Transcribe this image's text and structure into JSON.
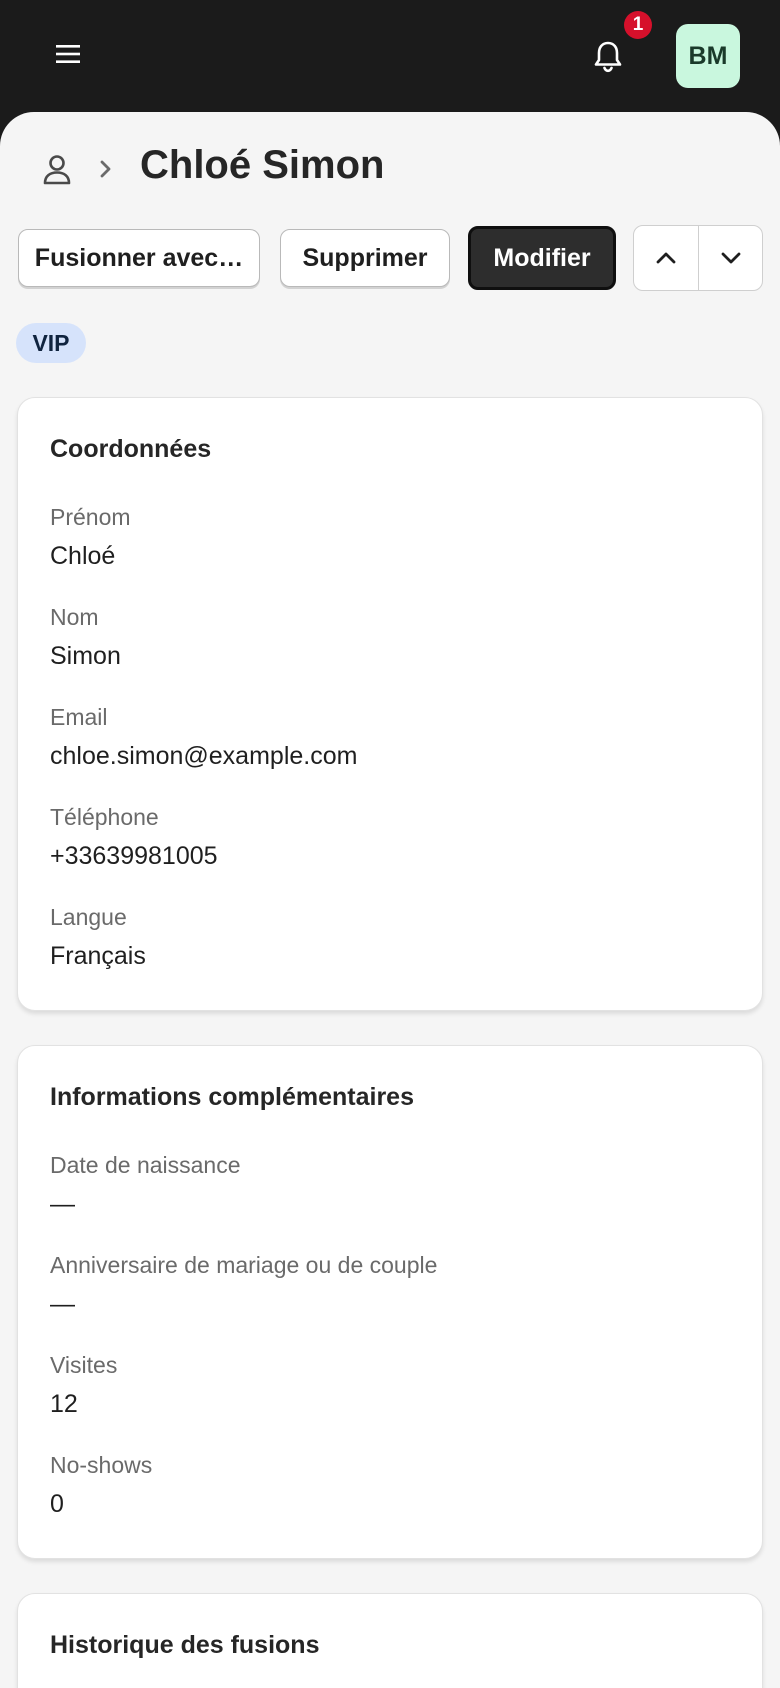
{
  "header": {
    "menu_icon": "hamburger-menu-icon",
    "bell_icon": "bell-icon",
    "notification_count": "1",
    "avatar_initials": "BM",
    "colors": {
      "bar": "#1b1b1b",
      "badge": "#d6102b",
      "avatar_bg": "#c9f7de"
    }
  },
  "breadcrumb": {
    "icon": "user-icon",
    "separator_icon": "chevron-right-icon",
    "title": "Chloé Simon"
  },
  "actions": {
    "merge_label": "Fusionner avec…",
    "delete_label": "Supprimer",
    "edit_label": "Modifier",
    "previous_icon": "chevron-up-icon",
    "next_icon": "chevron-down-icon"
  },
  "tags": [
    "VIP"
  ],
  "contact": {
    "title": "Coordonnées",
    "fields": [
      {
        "label": "Prénom",
        "value": "Chloé"
      },
      {
        "label": "Nom",
        "value": "Simon"
      },
      {
        "label": "Email",
        "value": "chloe.simon@example.com"
      },
      {
        "label": "Téléphone",
        "value": "+33639981005"
      },
      {
        "label": "Langue",
        "value": "Français"
      }
    ]
  },
  "extra": {
    "title": "Informations complémentaires",
    "fields": [
      {
        "label": "Date de naissance",
        "value": "—"
      },
      {
        "label": "Anniversaire de mariage ou de couple",
        "value": "—"
      },
      {
        "label": "Visites",
        "value": "12"
      },
      {
        "label": "No-shows",
        "value": "0"
      }
    ]
  },
  "history": {
    "title": "Historique des fusions"
  }
}
